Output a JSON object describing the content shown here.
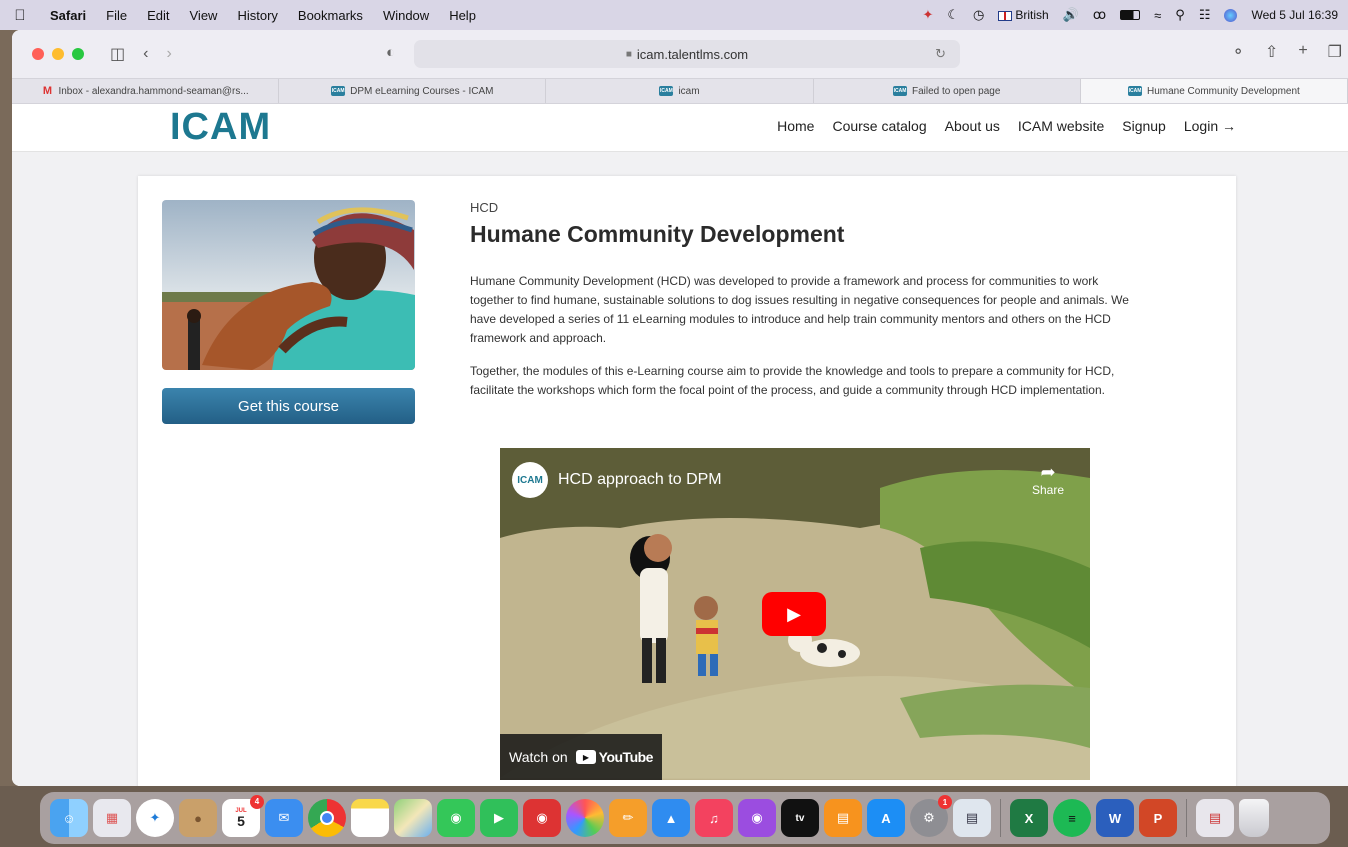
{
  "menubar": {
    "app": "Safari",
    "items": [
      "File",
      "Edit",
      "View",
      "History",
      "Bookmarks",
      "Window",
      "Help"
    ],
    "input_source": "British",
    "datetime": "Wed 5 Jul 16:39"
  },
  "browser": {
    "url": "icam.talentlms.com",
    "tabs": [
      {
        "label": "Inbox - alexandra.hammond-seaman@rs...",
        "icon": "gmail-icon"
      },
      {
        "label": "DPM eLearning Courses - ICAM",
        "icon": "icam-favicon"
      },
      {
        "label": "icam",
        "icon": "icam-favicon"
      },
      {
        "label": "Failed to open page",
        "icon": "icam-favicon"
      },
      {
        "label": "Humane Community Development",
        "icon": "icam-favicon"
      }
    ],
    "favicon_text": "ICAM"
  },
  "site": {
    "logo": "ICAM",
    "nav": [
      "Home",
      "Course catalog",
      "About us",
      "ICAM website",
      "Signup",
      "Login →"
    ],
    "accent": "#1d7890"
  },
  "course": {
    "category": "HCD",
    "title": "Humane Community Development",
    "cta_label": "Get this course",
    "paragraphs": [
      "Humane Community Development (HCD) was developed to provide a framework and process for communities to work together to find humane, sustainable solutions to dog issues resulting in negative consequences for people and animals. We have developed a series of 11 eLearning modules to introduce and help train community mentors and others on the HCD framework and approach.",
      "Together, the modules of this e-Learning course aim to provide the knowledge and tools to prepare a community for HCD, facilitate the workshops which form the focal point of the process, and guide a community through HCD implementation."
    ]
  },
  "video": {
    "channel_logo": "ICAM",
    "title": "HCD approach to DPM",
    "share_label": "Share",
    "watch_on": "Watch on",
    "youtube": "YouTube"
  },
  "dock": {
    "calendar_month": "JUL",
    "calendar_day": "5",
    "calendar_badge": "4",
    "settings_badge": "1"
  }
}
